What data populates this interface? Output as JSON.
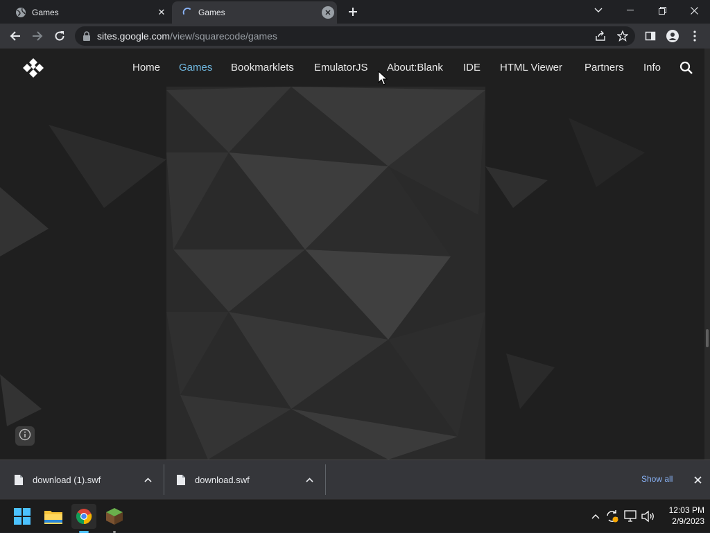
{
  "browser": {
    "tabs": [
      {
        "title": "Games",
        "favicon": "globe-icon"
      },
      {
        "title": "Games",
        "favicon": "loading-spinner-icon"
      }
    ],
    "url_host": "sites.google.com",
    "url_path": "/view/squarecode/games"
  },
  "site": {
    "nav": [
      {
        "label": "Home",
        "active": false
      },
      {
        "label": "Games",
        "active": true
      },
      {
        "label": "Bookmarklets",
        "active": false
      },
      {
        "label": "EmulatorJS",
        "active": false
      },
      {
        "label": "About:Blank",
        "active": false
      },
      {
        "label": "IDE",
        "active": false
      },
      {
        "label": "HTML Viewer",
        "active": false
      },
      {
        "label": "Partners",
        "active": false
      },
      {
        "label": "Info",
        "active": false
      }
    ],
    "accent_color": "#6fb7df"
  },
  "downloads": {
    "items": [
      {
        "filename": "download (1).swf"
      },
      {
        "filename": "download.swf"
      }
    ],
    "show_all_label": "Show all"
  },
  "taskbar": {
    "apps": [
      "windows-start-icon",
      "file-explorer-icon",
      "chrome-icon",
      "minecraft-icon"
    ],
    "time": "12:03 PM",
    "date": "2/9/2023"
  }
}
